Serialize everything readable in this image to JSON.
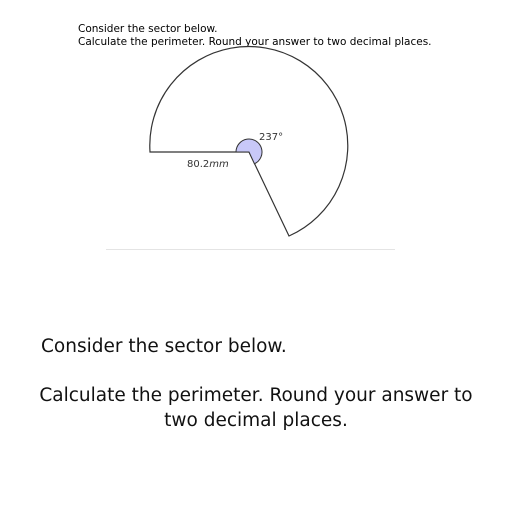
{
  "header": {
    "line1": "Consider the sector below.",
    "line2": "Calculate the perimeter. Round your answer to two decimal places."
  },
  "diagram": {
    "angle_label": "237°",
    "radius_value": "80.2",
    "radius_unit": "mm",
    "sector_angle_degrees": 237,
    "radius_mm": 80.2,
    "angle_fill_color": "#c8c8f8",
    "stroke_color": "#333333"
  },
  "body": {
    "line1": "Consider the sector below.",
    "line2": "Calculate the perimeter. Round your answer to two decimal places."
  }
}
